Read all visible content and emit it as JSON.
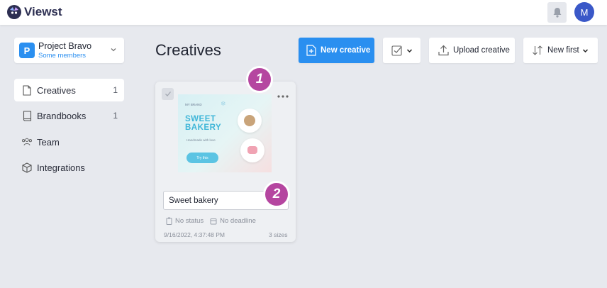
{
  "app": {
    "name": "Viewst"
  },
  "header": {
    "avatar_initial": "M",
    "bell_icon": "bell-icon"
  },
  "project": {
    "badge": "P",
    "name": "Project Bravo",
    "subtitle": "Some members"
  },
  "sidebar": {
    "items": [
      {
        "label": "Creatives",
        "count": "1",
        "icon": "file-icon",
        "active": true
      },
      {
        "label": "Brandbooks",
        "count": "1",
        "icon": "book-icon",
        "active": false
      },
      {
        "label": "Team",
        "count": "",
        "icon": "team-icon",
        "active": false
      },
      {
        "label": "Integrations",
        "count": "",
        "icon": "box-icon",
        "active": false
      }
    ]
  },
  "main": {
    "title": "Creatives",
    "toolbar": {
      "new_creative": "New creative",
      "upload_creative": "Upload creative",
      "sort": "New first"
    }
  },
  "card": {
    "name_value": "Sweet bakery",
    "status": "No status",
    "deadline": "No deadline",
    "date": "9/16/2022, 4:37:48 PM",
    "sizes": "3 sizes",
    "thumbnail": {
      "brand": "MY BRAND",
      "title_line1": "SWEET",
      "title_line2": "BAKERY",
      "tagline": "Handmade with love",
      "cta": "Try this"
    }
  },
  "annotations": {
    "step1": "1",
    "step2": "2"
  },
  "colors": {
    "primary": "#2a8ff0",
    "background": "#e7e9ee",
    "brand_dark": "#2d2f52",
    "step_badge": "#b546a0",
    "avatar": "#3a58c8"
  }
}
